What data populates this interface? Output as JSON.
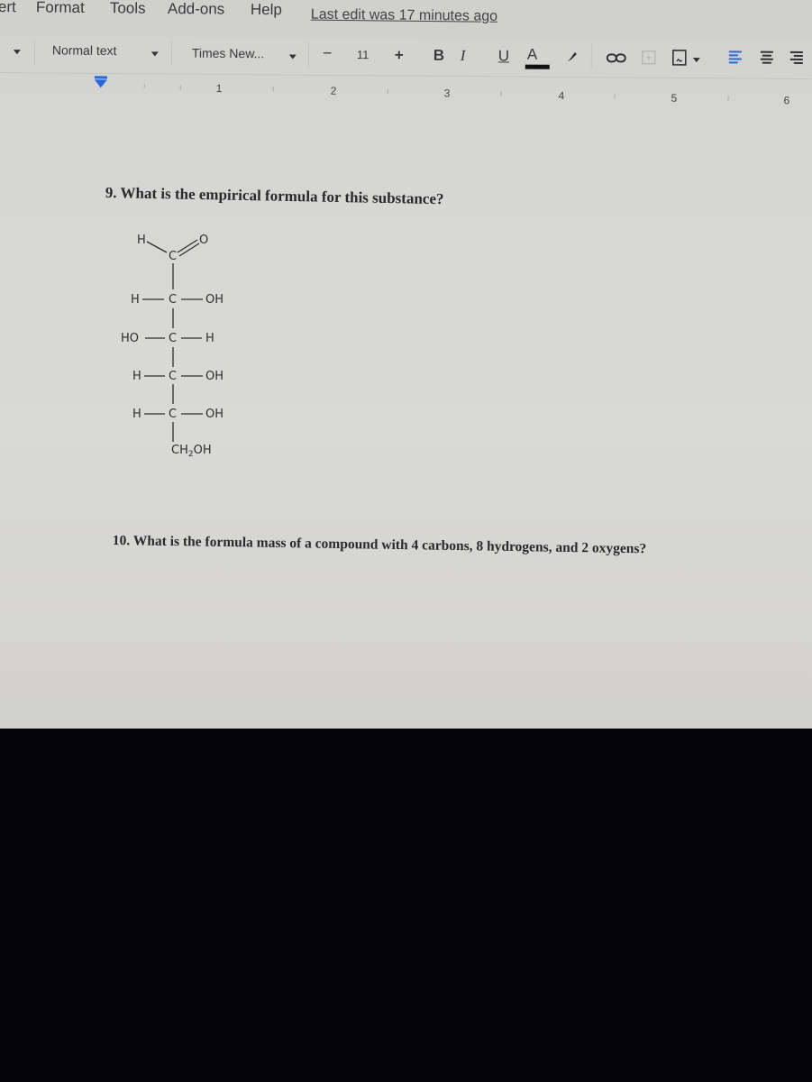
{
  "menubar": {
    "items": [
      "ert",
      "Format",
      "Tools",
      "Add-ons",
      "Help"
    ],
    "last_edit": "Last edit was 17 minutes ago"
  },
  "toolbar": {
    "paragraph_style": "Normal text",
    "font_family": "Times New...",
    "font_size": "11",
    "decrease_size": "−",
    "increase_size": "+",
    "bold": "B",
    "italic": "I",
    "underline": "U",
    "text_color": "A",
    "icons": [
      "highlight-icon",
      "link-icon",
      "comment-icon",
      "image-icon",
      "align-left-icon",
      "align-center-icon",
      "align-right-icon"
    ],
    "accent_color": "#2a6ad8"
  },
  "ruler": {
    "numbers": [
      "1",
      "2",
      "3",
      "4",
      "5",
      "6"
    ]
  },
  "document": {
    "question9": "9. What is the empirical formula for this substance?",
    "molecule": {
      "top_h": "H",
      "top_c": "C",
      "top_o": "O",
      "rows": [
        {
          "left": "H",
          "center": "C",
          "right": "OH"
        },
        {
          "left": "HO",
          "center": "C",
          "right": "H"
        },
        {
          "left": "H",
          "center": "C",
          "right": "OH"
        },
        {
          "left": "H",
          "center": "C",
          "right": "OH"
        }
      ],
      "bottom": "CH",
      "bottom_sub": "2",
      "bottom_tail": "OH"
    },
    "question10": "10. What is the formula mass of a compound with 4 carbons, 8 hydrogens, and 2 oxygens?"
  }
}
